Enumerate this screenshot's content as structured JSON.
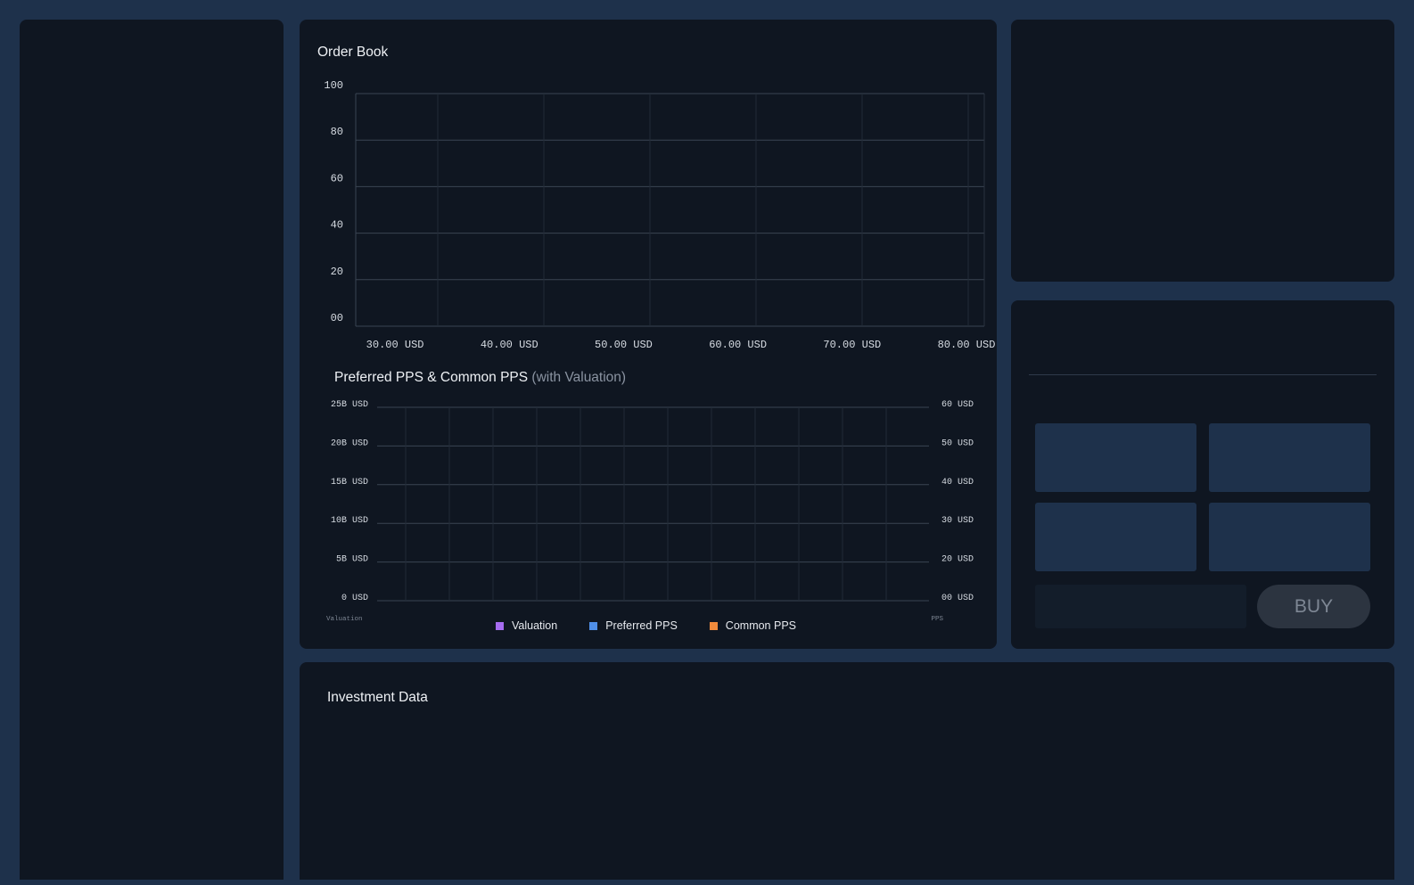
{
  "order_book": {
    "title": "Order Book"
  },
  "pps_chart": {
    "title": "Preferred PPS & Common PPS",
    "title_suffix": "(with Valuation)",
    "left_axis_label": "Valuation",
    "right_axis_label": "PPS",
    "legend": [
      {
        "label": "Valuation",
        "color": "#a66cf0"
      },
      {
        "label": "Preferred PPS",
        "color": "#4f8fe8"
      },
      {
        "label": "Common PPS",
        "color": "#f08a3c"
      }
    ]
  },
  "investment": {
    "title": "Investment Data"
  },
  "trade": {
    "buy_label": "BUY",
    "amount_value": ""
  },
  "colors": {
    "background": "#1e314b",
    "panel": "#0f1621",
    "tile": "#1e314b",
    "grid": "#2f3846",
    "button": "#2c3440"
  },
  "chart_data": [
    {
      "type": "bar",
      "title": "Order Book",
      "x_tick_labels": [
        "30.00 USD",
        "40.00 USD",
        "50.00 USD",
        "60.00 USD",
        "70.00 USD",
        "80.00 USD"
      ],
      "y_tick_labels": [
        "100",
        "80",
        "60",
        "40",
        "20",
        "00"
      ],
      "xlim": [
        25,
        80
      ],
      "ylim": [
        0,
        100
      ],
      "series": [],
      "grid": true
    },
    {
      "type": "line",
      "title": "Preferred PPS & Common PPS (with Valuation)",
      "ylabel": "Valuation",
      "y2label": "PPS",
      "y_tick_labels": [
        "25B USD",
        "20B USD",
        "15B USD",
        "10B USD",
        "5B USD",
        "0 USD"
      ],
      "y2_tick_labels": [
        "60 USD",
        "50 USD",
        "40 USD",
        "30 USD",
        "20 USD",
        "00 USD"
      ],
      "ylim": [
        0,
        25000000000
      ],
      "y2lim": [
        0,
        60
      ],
      "series": [
        {
          "name": "Valuation",
          "values": []
        },
        {
          "name": "Preferred PPS",
          "values": []
        },
        {
          "name": "Common PPS",
          "values": []
        }
      ],
      "grid": true,
      "legend_position": "bottom"
    }
  ]
}
